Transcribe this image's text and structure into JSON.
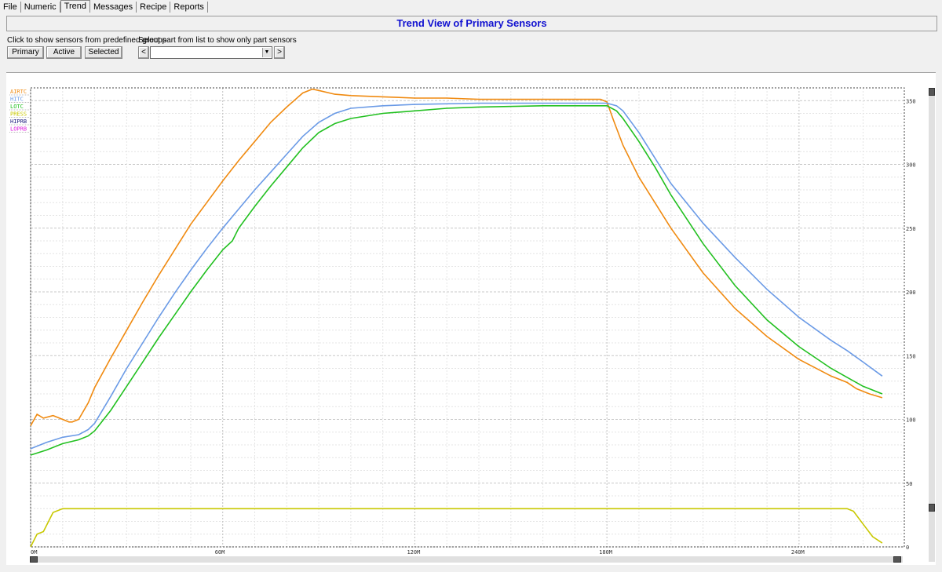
{
  "tabs": [
    {
      "label": "File",
      "active": false
    },
    {
      "label": "Numeric",
      "active": false
    },
    {
      "label": "Trend",
      "active": true
    },
    {
      "label": "Messages",
      "active": false
    },
    {
      "label": "Recipe",
      "active": false
    },
    {
      "label": "Reports",
      "active": false
    }
  ],
  "header": {
    "title": "Trend View of Primary Sensors"
  },
  "controls": {
    "group_hint": "Click to show sensors from predefined groups",
    "part_hint": "Select part from list to show only part sensors",
    "btn_primary": "Primary",
    "btn_active": "Active",
    "btn_selected": "Selected",
    "prev_label": "<",
    "next_label": ">",
    "part_value": ""
  },
  "colors": {
    "AIRTC": "#f08a10",
    "HITC": "#6a9ae6",
    "LOTC": "#22c020",
    "PRESS": "#c8c800",
    "HIPRB": "#202080",
    "LOPRB": "#e020e0"
  },
  "chart_data": {
    "type": "line",
    "x_unit": "minutes",
    "xlim": [
      0,
      267
    ],
    "ylim": [
      0,
      360
    ],
    "x_ticks": [
      {
        "v": 0,
        "label": "0M"
      },
      {
        "v": 60,
        "label": "60M"
      },
      {
        "v": 120,
        "label": "120M"
      },
      {
        "v": 180,
        "label": "180M"
      },
      {
        "v": 240,
        "label": "240M"
      }
    ],
    "y_ticks": [
      {
        "v": 0,
        "label": "0"
      },
      {
        "v": 50,
        "label": "50"
      },
      {
        "v": 100,
        "label": "100"
      },
      {
        "v": 150,
        "label": "150"
      },
      {
        "v": 200,
        "label": "200"
      },
      {
        "v": 250,
        "label": "250"
      },
      {
        "v": 300,
        "label": "300"
      },
      {
        "v": 350,
        "label": "350"
      }
    ],
    "grid": true,
    "legend": "top-left",
    "series": [
      {
        "name": "AIRTC",
        "points": [
          [
            0,
            95
          ],
          [
            2,
            104
          ],
          [
            4,
            101
          ],
          [
            7,
            103
          ],
          [
            10,
            100
          ],
          [
            12,
            98
          ],
          [
            13,
            98
          ],
          [
            15,
            100
          ],
          [
            18,
            113
          ],
          [
            20,
            125
          ],
          [
            25,
            148
          ],
          [
            30,
            170
          ],
          [
            35,
            192
          ],
          [
            40,
            213
          ],
          [
            45,
            233
          ],
          [
            50,
            253
          ],
          [
            55,
            270
          ],
          [
            60,
            287
          ],
          [
            65,
            303
          ],
          [
            70,
            318
          ],
          [
            75,
            333
          ],
          [
            80,
            345
          ],
          [
            85,
            356
          ],
          [
            88,
            359
          ],
          [
            90,
            358
          ],
          [
            95,
            355
          ],
          [
            100,
            354
          ],
          [
            110,
            353
          ],
          [
            120,
            352
          ],
          [
            130,
            352
          ],
          [
            140,
            351
          ],
          [
            160,
            351
          ],
          [
            175,
            351
          ],
          [
            178,
            351
          ],
          [
            180,
            349
          ],
          [
            182,
            335
          ],
          [
            185,
            315
          ],
          [
            190,
            290
          ],
          [
            200,
            250
          ],
          [
            210,
            215
          ],
          [
            220,
            187
          ],
          [
            230,
            165
          ],
          [
            240,
            147
          ],
          [
            250,
            134
          ],
          [
            255,
            129
          ],
          [
            258,
            124
          ],
          [
            262,
            120
          ],
          [
            266,
            117
          ]
        ]
      },
      {
        "name": "HITC",
        "points": [
          [
            0,
            77
          ],
          [
            5,
            82
          ],
          [
            10,
            86
          ],
          [
            15,
            88
          ],
          [
            18,
            92
          ],
          [
            20,
            97
          ],
          [
            25,
            118
          ],
          [
            30,
            140
          ],
          [
            35,
            160
          ],
          [
            40,
            180
          ],
          [
            45,
            199
          ],
          [
            50,
            217
          ],
          [
            55,
            234
          ],
          [
            60,
            250
          ],
          [
            65,
            265
          ],
          [
            70,
            280
          ],
          [
            75,
            294
          ],
          [
            80,
            308
          ],
          [
            85,
            322
          ],
          [
            90,
            333
          ],
          [
            95,
            340
          ],
          [
            100,
            344
          ],
          [
            110,
            346
          ],
          [
            120,
            347
          ],
          [
            140,
            348
          ],
          [
            160,
            348
          ],
          [
            175,
            348
          ],
          [
            180,
            348
          ],
          [
            183,
            346
          ],
          [
            185,
            342
          ],
          [
            190,
            325
          ],
          [
            195,
            305
          ],
          [
            200,
            285
          ],
          [
            210,
            254
          ],
          [
            220,
            227
          ],
          [
            230,
            202
          ],
          [
            240,
            180
          ],
          [
            250,
            162
          ],
          [
            255,
            154
          ],
          [
            260,
            145
          ],
          [
            266,
            134
          ]
        ]
      },
      {
        "name": "LOTC",
        "points": [
          [
            0,
            72
          ],
          [
            5,
            76
          ],
          [
            10,
            81
          ],
          [
            15,
            84
          ],
          [
            18,
            87
          ],
          [
            20,
            91
          ],
          [
            25,
            107
          ],
          [
            30,
            126
          ],
          [
            35,
            145
          ],
          [
            40,
            164
          ],
          [
            45,
            182
          ],
          [
            50,
            200
          ],
          [
            55,
            217
          ],
          [
            60,
            233
          ],
          [
            63,
            240
          ],
          [
            65,
            250
          ],
          [
            70,
            267
          ],
          [
            75,
            283
          ],
          [
            80,
            298
          ],
          [
            85,
            313
          ],
          [
            90,
            325
          ],
          [
            95,
            332
          ],
          [
            100,
            336
          ],
          [
            110,
            340
          ],
          [
            120,
            342
          ],
          [
            130,
            344
          ],
          [
            140,
            345
          ],
          [
            160,
            346
          ],
          [
            175,
            346
          ],
          [
            180,
            346
          ],
          [
            183,
            342
          ],
          [
            185,
            336
          ],
          [
            190,
            318
          ],
          [
            195,
            298
          ],
          [
            200,
            276
          ],
          [
            210,
            238
          ],
          [
            220,
            205
          ],
          [
            230,
            178
          ],
          [
            240,
            157
          ],
          [
            250,
            140
          ],
          [
            255,
            133
          ],
          [
            260,
            126
          ],
          [
            266,
            120
          ]
        ]
      },
      {
        "name": "PRESS",
        "points": [
          [
            0,
            0
          ],
          [
            2,
            10
          ],
          [
            4,
            12
          ],
          [
            7,
            27
          ],
          [
            10,
            30
          ],
          [
            50,
            30
          ],
          [
            100,
            30
          ],
          [
            150,
            30
          ],
          [
            200,
            30
          ],
          [
            255,
            30
          ],
          [
            257,
            28
          ],
          [
            260,
            18
          ],
          [
            263,
            8
          ],
          [
            266,
            3
          ]
        ]
      },
      {
        "name": "HIPRB",
        "points": []
      },
      {
        "name": "LOPRB",
        "points": []
      }
    ]
  }
}
